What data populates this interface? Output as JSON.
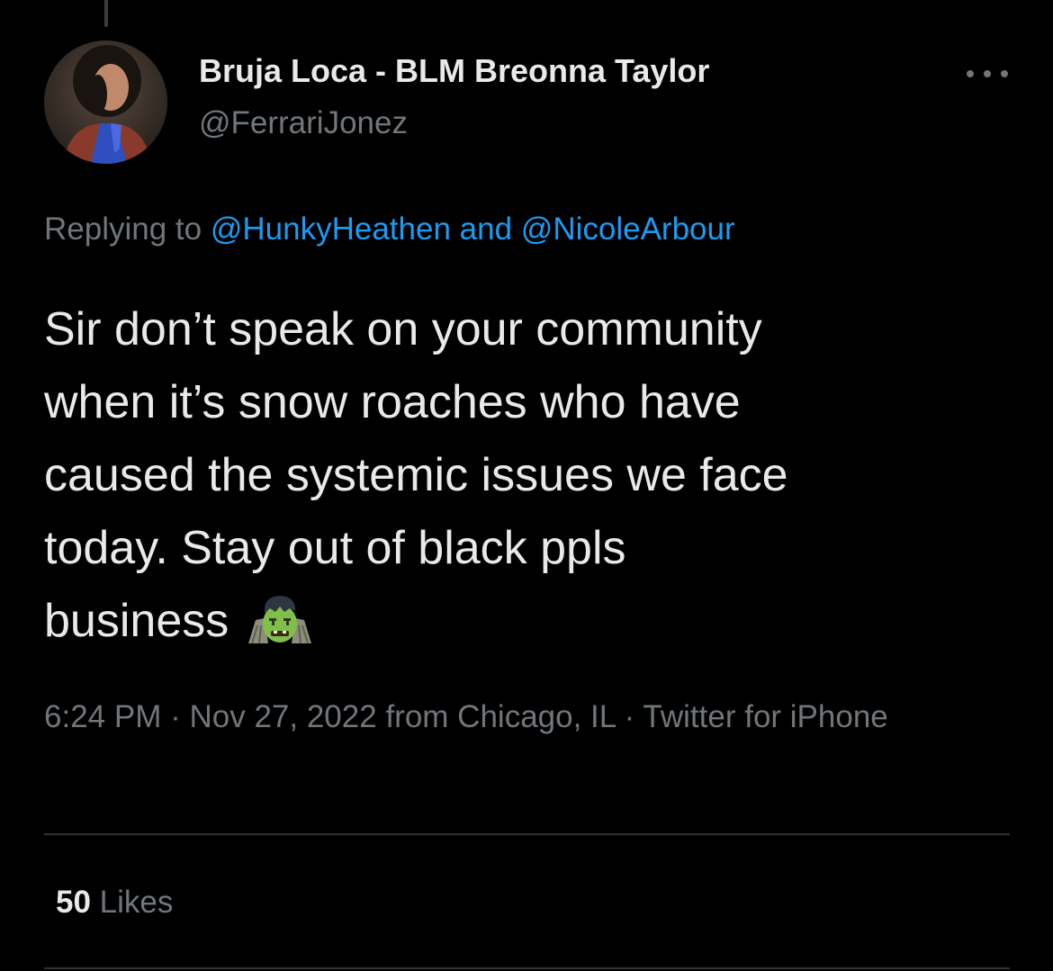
{
  "tweet": {
    "author": {
      "display_name": "Bruja Loca - BLM Breonna Taylor",
      "handle": "@FerrariJonez",
      "avatar_icon": "profile-photo"
    },
    "more_icon": "ellipsis-icon",
    "replying": {
      "prefix": "Replying to",
      "mention_1": "@HunkyHeathen",
      "conjunction": "and",
      "mention_2": "@NicoleArbour"
    },
    "text_lines": [
      "Sir don’t speak on your community",
      "when it’s snow roaches who have",
      "caused the systemic issues we face",
      "today. Stay out of black ppls",
      "business"
    ],
    "emoji": "zombie-emoji",
    "meta": {
      "time": "6:24 PM",
      "sep1": "·",
      "date": "Nov 27, 2022",
      "from_text": "from",
      "location": "Chicago, IL",
      "sep2": "·",
      "client": "Twitter for iPhone"
    },
    "likes": {
      "count": "50",
      "label": "Likes"
    }
  },
  "colors": {
    "background": "#000000",
    "primary_text": "#e7e9ea",
    "secondary_text": "#71767b",
    "link": "#1d9bf0",
    "divider": "#2f3336"
  }
}
